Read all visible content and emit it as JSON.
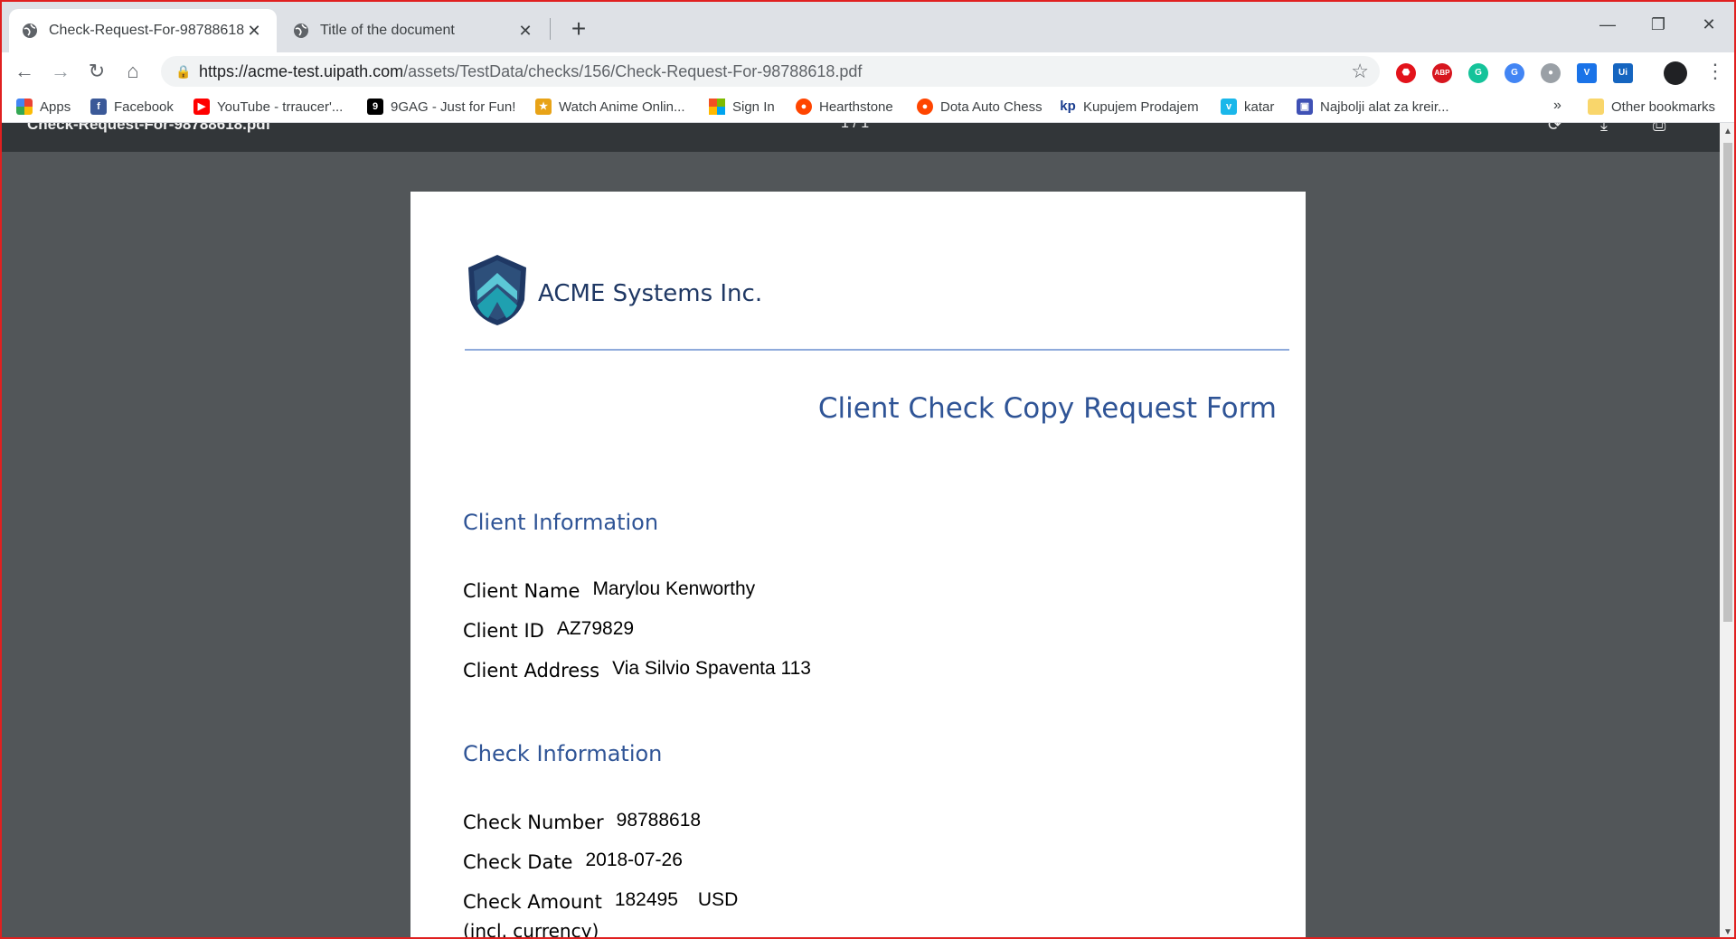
{
  "tabs": [
    {
      "title": "Check-Request-For-98788618.pdf",
      "active": true
    },
    {
      "title": "Title of the document",
      "active": false
    }
  ],
  "toolbar": {
    "url_host": "https://acme-test.uipath.com",
    "url_path": "/assets/TestData/checks/156/Check-Request-For-98788618.pdf"
  },
  "bookmarks": [
    {
      "label": "Apps",
      "icon": "apps-grid-icon",
      "color": "#4285f4"
    },
    {
      "label": "Facebook",
      "icon": "facebook-icon",
      "color": "#3b5998"
    },
    {
      "label": "YouTube - trraucer'...",
      "icon": "youtube-icon",
      "color": "#ff0000"
    },
    {
      "label": "9GAG - Just for Fun!",
      "icon": "9gag-icon",
      "color": "#000000"
    },
    {
      "label": "Watch Anime Onlin...",
      "icon": "anime-icon",
      "color": "#e8a317"
    },
    {
      "label": "Sign In",
      "icon": "microsoft-icon",
      "color": "#f25022"
    },
    {
      "label": "Hearthstone",
      "icon": "reddit-icon",
      "color": "#ff4500"
    },
    {
      "label": "Dota Auto Chess",
      "icon": "reddit-icon",
      "color": "#ff4500"
    },
    {
      "label": "Kupujem Prodajem",
      "icon": "kp-icon",
      "color": "#1a3d8f"
    },
    {
      "label": "katar",
      "icon": "vimeo-icon",
      "color": "#1ab7ea"
    },
    {
      "label": "Najbolji alat za kreir...",
      "icon": "canva-icon",
      "color": "#3f51b5"
    }
  ],
  "bookmarks_more": "»",
  "other_bookmarks": "Other bookmarks",
  "pdf": {
    "filename": "Check-Request-For-98788618.pdf",
    "pages": "1 / 1"
  },
  "document": {
    "company": "ACME Systems Inc.",
    "form_title": "Client Check Copy Request Form",
    "client_section": "Client Information",
    "client_name_label": "Client Name",
    "client_name": "Marylou Kenworthy",
    "client_id_label": "Client ID",
    "client_id": "AZ79829",
    "client_address_label": "Client Address",
    "client_address": "Via Silvio Spaventa 113",
    "check_section": "Check Information",
    "check_number_label": "Check Number",
    "check_number": "98788618",
    "check_date_label": "Check Date",
    "check_date": "2018-07-26",
    "check_amount_label": "Check Amount",
    "check_amount": "182495",
    "check_currency": "USD",
    "check_amount_sub": "(incl. currency)"
  }
}
